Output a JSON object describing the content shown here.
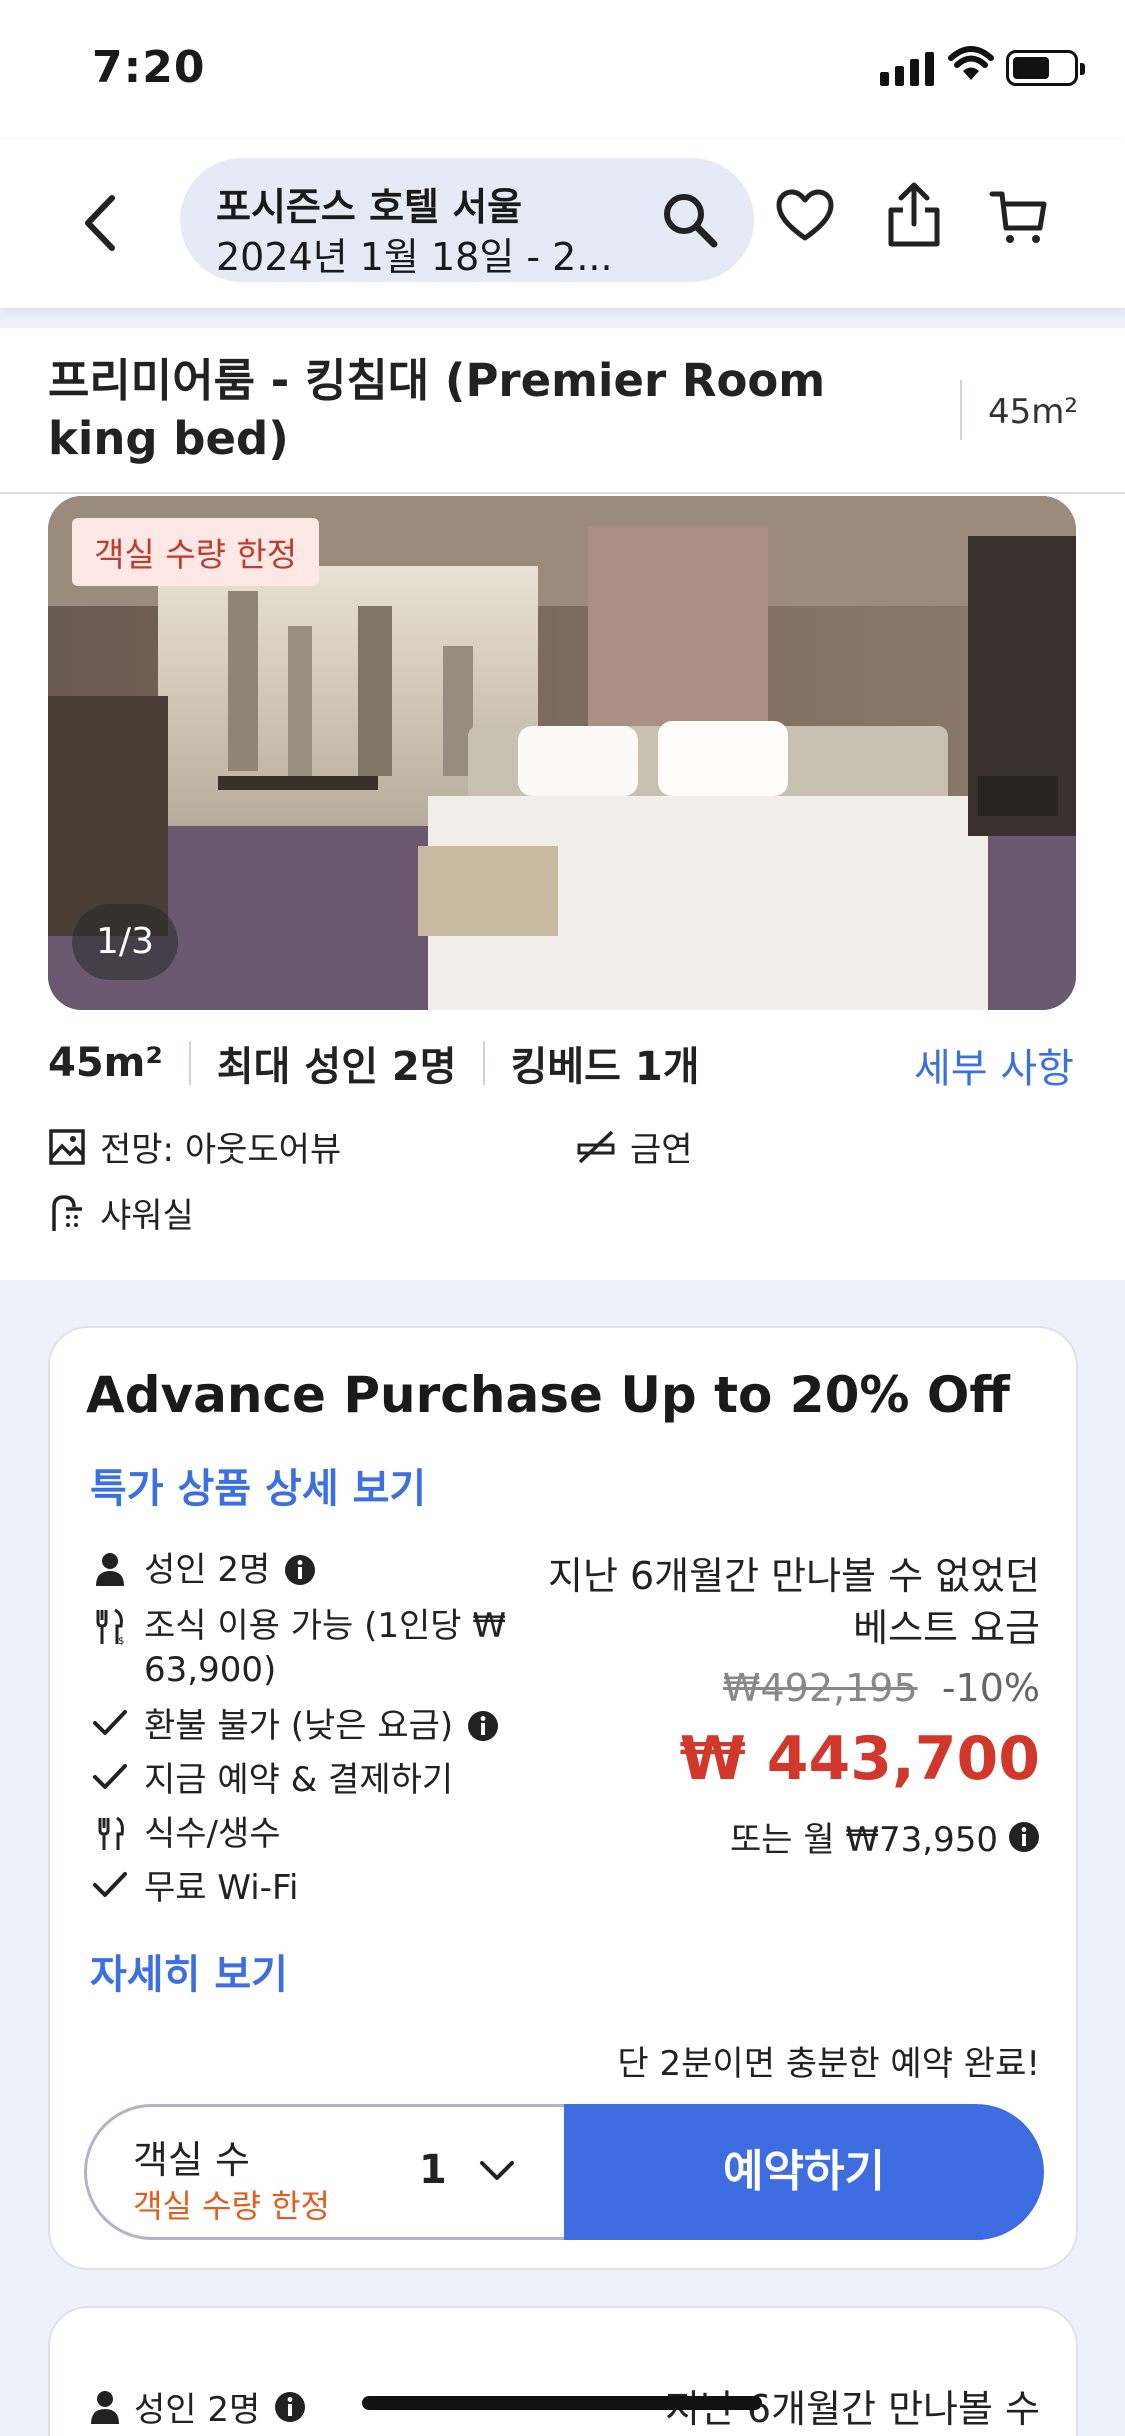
{
  "status": {
    "time": "7:20"
  },
  "search": {
    "hotel": "포시즌스 호텔 서울",
    "dates": "2024년 1월 18일 - 2..."
  },
  "room": {
    "name": "프리미어룸 - 킹침대 (Premier Room king bed)",
    "size": "45m²",
    "badge": "객실 수량 한정",
    "photo_counter": "1/3",
    "specs": [
      "45m²",
      "최대 성인 2명",
      "킹베드 1개"
    ],
    "details_link": "세부 사항",
    "amenities": {
      "view": "전망: 아웃도어뷰",
      "smoking": "금연",
      "bath": "샤워실"
    }
  },
  "offer": {
    "title": "Advance Purchase Up to 20% Off",
    "deal_link": "특가 상품 상세 보기",
    "features": {
      "adults": "성인 2명",
      "breakfast": "조식 이용 가능 (1인당 ₩ 63,900)",
      "refund": "환불 불가 (낮은 요금)",
      "pay_now": "지금 예약 & 결제하기",
      "dining": "식수/생수",
      "wifi": "무료 Wi-Fi"
    },
    "price_note": "지난 6개월간 만나볼 수 없었던 베스트 요금",
    "original_price": "₩492,195",
    "discount": "-10%",
    "final_price": "₩ 443,700",
    "monthly": "또는 월 ₩73,950",
    "more_link": "자세히 보기",
    "fast_note": "단 2분이면 충분한 예약 완료!",
    "rooms_label": "객실 수",
    "rooms_sub": "객실 수량 한정",
    "rooms_value": "1",
    "book_label": "예약하기"
  },
  "offer2": {
    "adults": "성인 2명",
    "note": "지난 6개월간 만나볼 수"
  },
  "colors": {
    "accent": "#3d6de1",
    "price": "#d2372b",
    "warning": "#e25d1e"
  }
}
